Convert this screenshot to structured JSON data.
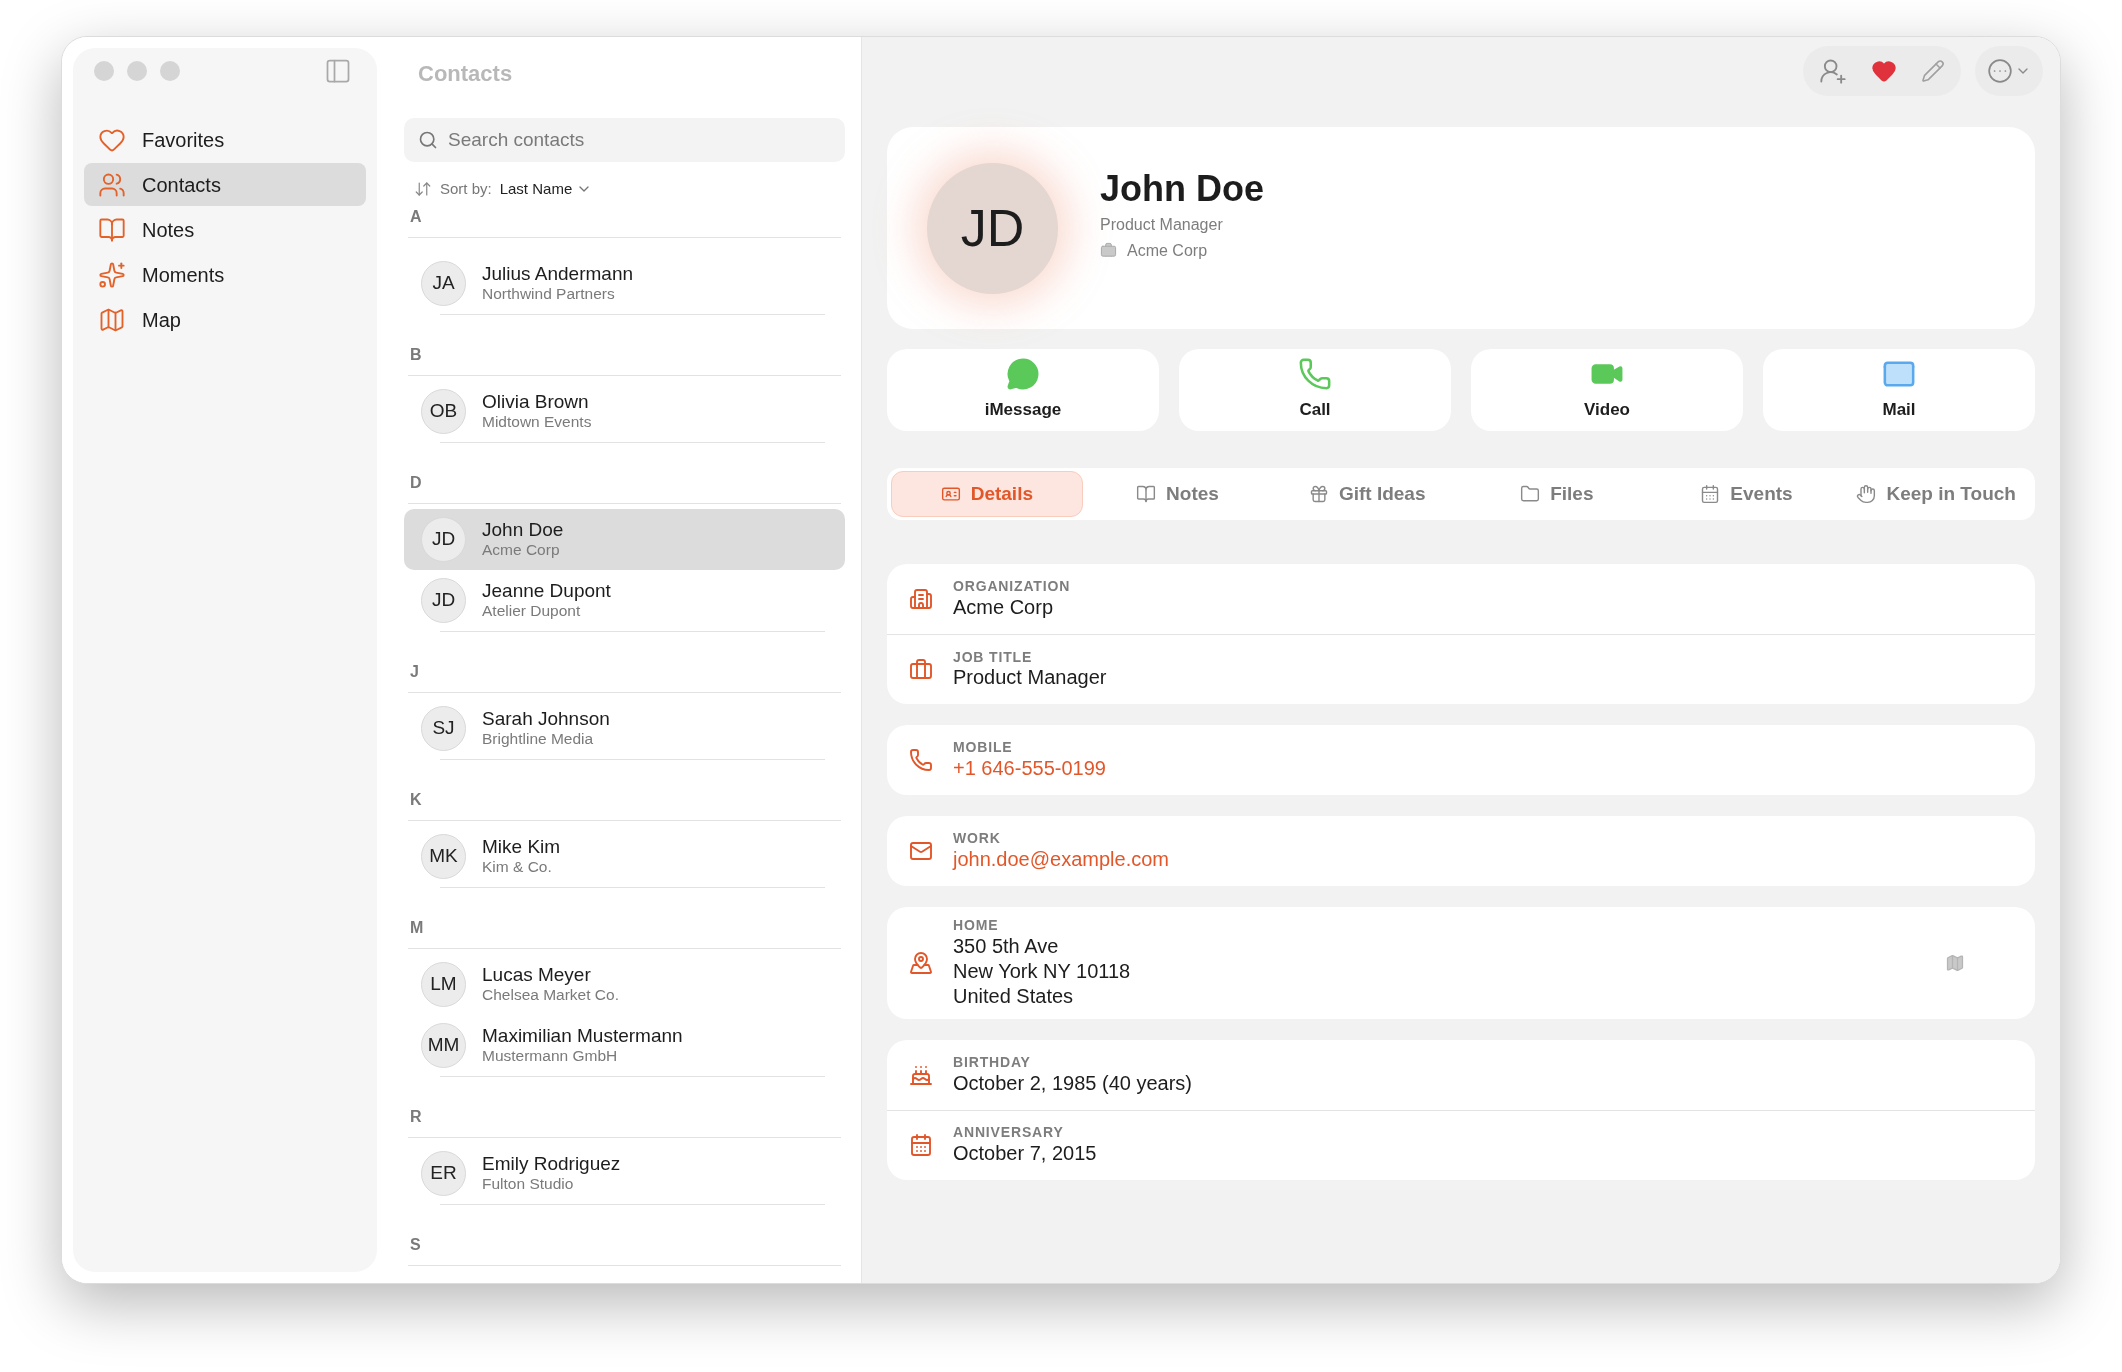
{
  "sidebar": {
    "items": [
      {
        "label": "Favorites",
        "kind": "heart",
        "selected": false
      },
      {
        "label": "Contacts",
        "kind": "people",
        "selected": true
      },
      {
        "label": "Notes",
        "kind": "book",
        "selected": false
      },
      {
        "label": "Moments",
        "kind": "sparkles",
        "selected": false
      },
      {
        "label": "Map",
        "kind": "map",
        "selected": false
      }
    ]
  },
  "list": {
    "title": "Contacts",
    "search": {
      "placeholder": "Search contacts"
    },
    "sort": {
      "label": "Sort by:",
      "value": "Last Name"
    },
    "sections": [
      {
        "letter": "A",
        "contacts": [
          {
            "initials": "JA",
            "name": "Julius Andermann",
            "company": "Northwind Partners",
            "selected": false
          }
        ]
      },
      {
        "letter": "B",
        "contacts": [
          {
            "initials": "OB",
            "name": "Olivia Brown",
            "company": "Midtown Events",
            "selected": false
          }
        ]
      },
      {
        "letter": "D",
        "contacts": [
          {
            "initials": "JD",
            "name": "John Doe",
            "company": "Acme Corp",
            "selected": true
          },
          {
            "initials": "JD",
            "name": "Jeanne Dupont",
            "company": "Atelier Dupont",
            "selected": false
          }
        ]
      },
      {
        "letter": "J",
        "contacts": [
          {
            "initials": "SJ",
            "name": "Sarah Johnson",
            "company": "Brightline Media",
            "selected": false
          }
        ]
      },
      {
        "letter": "K",
        "contacts": [
          {
            "initials": "MK",
            "name": "Mike Kim",
            "company": "Kim & Co.",
            "selected": false
          }
        ]
      },
      {
        "letter": "M",
        "contacts": [
          {
            "initials": "LM",
            "name": "Lucas Meyer",
            "company": "Chelsea Market Co.",
            "selected": false
          },
          {
            "initials": "MM",
            "name": "Maximilian Mustermann",
            "company": "Mustermann GmbH",
            "selected": false
          }
        ]
      },
      {
        "letter": "R",
        "contacts": [
          {
            "initials": "ER",
            "name": "Emily Rodriguez",
            "company": "Fulton Studio",
            "selected": false
          }
        ]
      },
      {
        "letter": "S"
      }
    ]
  },
  "toolbar": {
    "favorite": true
  },
  "profile": {
    "initials": "JD",
    "name": "John Doe",
    "title": "Product Manager",
    "company": "Acme Corp"
  },
  "actions": [
    {
      "label": "iMessage",
      "kind": "message"
    },
    {
      "label": "Call",
      "kind": "phone"
    },
    {
      "label": "Video",
      "kind": "video"
    },
    {
      "label": "Mail",
      "kind": "mail"
    }
  ],
  "tabs": [
    {
      "label": "Details",
      "kind": "card",
      "selected": true
    },
    {
      "label": "Notes",
      "kind": "book",
      "selected": false
    },
    {
      "label": "Gift Ideas",
      "kind": "gift",
      "selected": false
    },
    {
      "label": "Files",
      "kind": "folder",
      "selected": false
    },
    {
      "label": "Events",
      "kind": "calendar",
      "selected": false
    },
    {
      "label": "Keep in Touch",
      "kind": "hand",
      "selected": false
    }
  ],
  "field_groups": [
    {
      "fields": [
        {
          "kind": "building",
          "label": "ORGANIZATION",
          "lines": [
            "Acme Corp"
          ],
          "link": false
        },
        {
          "kind": "briefcase",
          "label": "JOB TITLE",
          "lines": [
            "Product Manager"
          ],
          "link": false
        }
      ]
    },
    {
      "fields": [
        {
          "kind": "phone",
          "label": "MOBILE",
          "lines": [
            "+1 646-555-0199"
          ],
          "link": true
        }
      ]
    },
    {
      "fields": [
        {
          "kind": "mail",
          "label": "WORK",
          "lines": [
            "john.doe@example.com"
          ],
          "link": true
        }
      ]
    },
    {
      "fields": [
        {
          "kind": "pin",
          "label": "HOME",
          "lines": [
            "350 5th Ave",
            "New York NY 10118",
            "United States"
          ],
          "link": false,
          "map_button": true
        }
      ]
    },
    {
      "fields": [
        {
          "kind": "cake",
          "label": "BIRTHDAY",
          "lines": [
            "October 2, 1985 (40 years)"
          ],
          "link": false
        },
        {
          "kind": "calendar",
          "label": "ANNIVERSARY",
          "lines": [
            "October 7, 2015"
          ],
          "link": false
        }
      ]
    }
  ]
}
